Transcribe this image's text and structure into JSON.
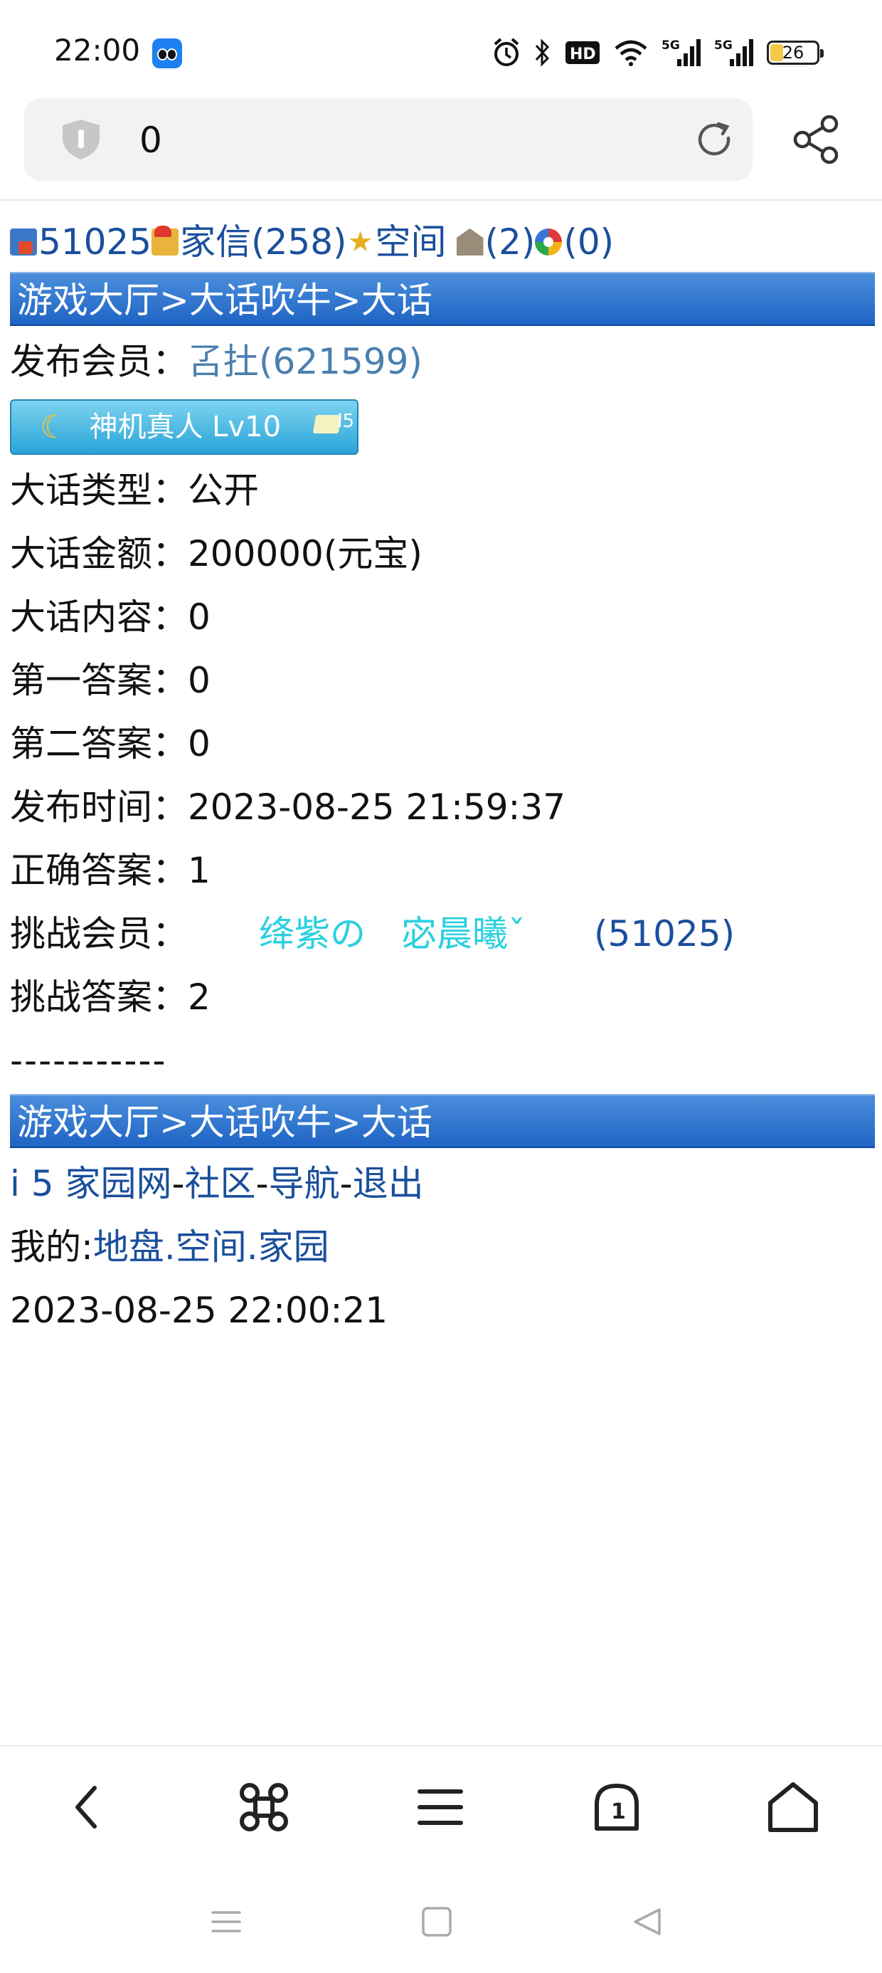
{
  "status_bar": {
    "time": "22:00",
    "icons": [
      "app-icon",
      "alarm-icon",
      "bluetooth-icon",
      "hd-icon",
      "wifi-icon",
      "signal-5g-icon",
      "signal-5g-icon",
      "battery-icon"
    ],
    "hd_label": "HD",
    "network_label": "5G",
    "battery": "26"
  },
  "address_bar": {
    "text": "0",
    "icons": [
      "shield-icon",
      "reload-icon",
      "share-icon"
    ]
  },
  "top_links": {
    "user_id": "51025",
    "mail": "家信(258)",
    "space": "空间",
    "house": "(2)",
    "wheel": "(0)"
  },
  "breadcrumb": "游戏大厅>大话吹牛>大话",
  "details": {
    "publisher_label": "发布会员：",
    "publisher_value": "叾扗(621599)",
    "badge_text": "神机真人 Lv10",
    "badge_tag": "i5",
    "type_label": "大话类型：",
    "type_value": "公开",
    "amount_label": "大话金额：",
    "amount_value": "200000(元宝)",
    "content_label": "大话内容：",
    "content_value": "0",
    "answer1_label": "第一答案：",
    "answer1_value": "0",
    "answer2_label": "第二答案：",
    "answer2_value": "0",
    "time_label": "发布时间：",
    "time_value": "2023-08-25 21:59:37",
    "correct_label": "正确答案：",
    "correct_value": "1",
    "challenger_label": "挑战会员：",
    "challenger_name": "绛紫の　宓晨曦ˇ",
    "challenger_id": "(51025)",
    "challenge_answer_label": "挑战答案：",
    "challenge_answer_value": "2"
  },
  "separator": "-----------",
  "footer": {
    "breadcrumb": "游戏大厅>大话吹牛>大话",
    "site": "i 5 家园网",
    "dash1": "-",
    "community": "社区",
    "dash2": "-",
    "nav": "导航",
    "dash3": "-",
    "logout": "退出",
    "mine_label": "我的:",
    "land": "地盘",
    "dot1": ".",
    "space": "空间",
    "dot2": ".",
    "home": "家园",
    "timestamp": "2023-08-25 22:00:21"
  },
  "browser_nav": {
    "icons": [
      "back-icon",
      "command-icon",
      "menu-icon",
      "tabs-icon",
      "home-icon"
    ],
    "tab_count": "1"
  },
  "system_nav": {
    "icons": [
      "recents-icon",
      "home-square-icon",
      "back-triangle-icon"
    ]
  },
  "colors": {
    "link": "#1a4f9c",
    "bar_blue": "#1f64c4",
    "challenger_cyan": "#2ad0e0",
    "badge_blue": "#2aa4d8"
  }
}
